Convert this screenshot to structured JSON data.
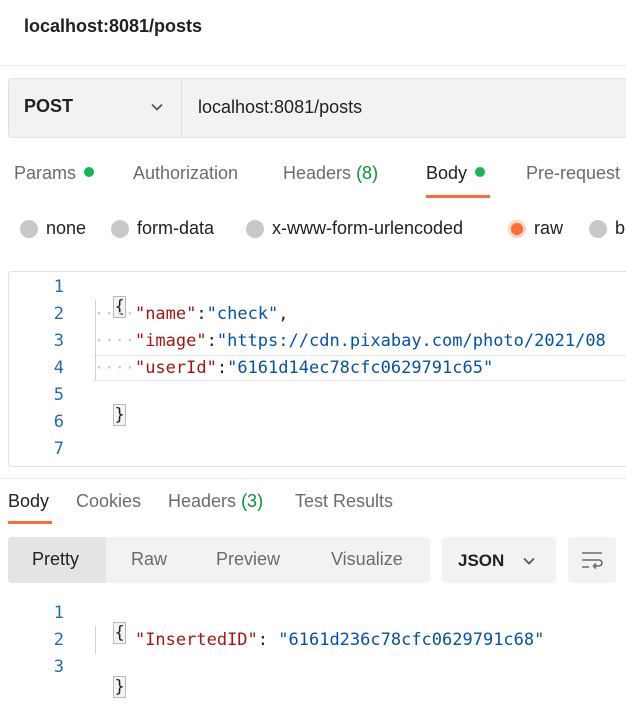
{
  "window": {
    "title": "localhost:8081/posts"
  },
  "request": {
    "method": "POST",
    "url": "localhost:8081/posts"
  },
  "tabs": {
    "params": "Params",
    "authorization": "Authorization",
    "headers": "Headers",
    "headers_count": "(8)",
    "body": "Body",
    "prerequest": "Pre-request"
  },
  "body_types": {
    "none": "none",
    "form_data": "form-data",
    "urlencoded": "x-www-form-urlencoded",
    "raw": "raw",
    "binary": "b",
    "selected": "raw"
  },
  "request_body": {
    "line_numbers": [
      "1",
      "2",
      "3",
      "4",
      "5",
      "6",
      "7"
    ],
    "open_brace": "{",
    "close_brace": "}",
    "name_key": "\"name\"",
    "name_value": "\"check\"",
    "image_key": "\"image\"",
    "image_value": "\"https://cdn.pixabay.com/photo/2021/08",
    "userid_key": "\"userId\"",
    "userid_value": "\"6161d14ec78cfc0629791c65\""
  },
  "response_tabs": {
    "body": "Body",
    "cookies": "Cookies",
    "headers": "Headers",
    "headers_count": "(3)",
    "test_results": "Test Results"
  },
  "response_view": {
    "pretty": "Pretty",
    "raw": "Raw",
    "preview": "Preview",
    "visualize": "Visualize",
    "format": "JSON"
  },
  "response_body": {
    "line_numbers": [
      "1",
      "2",
      "3"
    ],
    "open_brace": "{",
    "close_brace": "}",
    "key": "\"InsertedID\"",
    "value": "\"6161d236c78cfc0629791c68\""
  },
  "colors": {
    "accent": "#ff6c37",
    "status_dot": "#0cbb52",
    "json_key": "#a31515",
    "json_string": "#0451a5"
  }
}
